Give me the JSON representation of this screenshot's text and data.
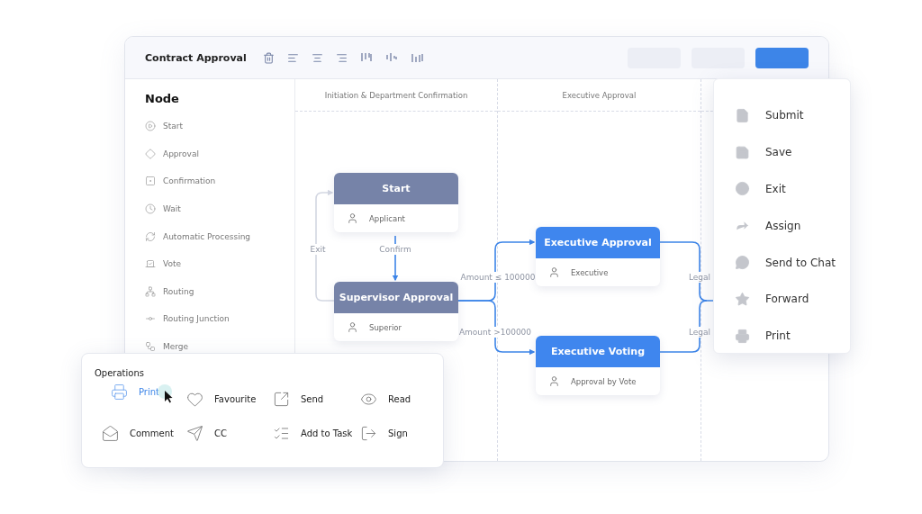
{
  "window": {
    "title": "Contract Approval"
  },
  "header_buttons": [
    {
      "primary": false
    },
    {
      "primary": false
    },
    {
      "primary": true
    }
  ],
  "sidebar": {
    "title": "Node",
    "items": [
      {
        "label": "Start"
      },
      {
        "label": "Approval"
      },
      {
        "label": "Confirmation"
      },
      {
        "label": "Wait"
      },
      {
        "label": "Automatic Processing"
      },
      {
        "label": "Vote"
      },
      {
        "label": "Routing"
      },
      {
        "label": "Routing Junction"
      },
      {
        "label": "Merge"
      }
    ]
  },
  "lanes": [
    {
      "title": "Initiation & Department Confirmation"
    },
    {
      "title": "Executive Approval"
    }
  ],
  "nodes": [
    {
      "title": "Start",
      "assignee": "Applicant",
      "color": "#7683a8"
    },
    {
      "title": "Supervisor Approval",
      "assignee": "Superior",
      "color": "#7683a8"
    },
    {
      "title": "Executive Approval",
      "assignee": "Executive",
      "color": "#3f86ee"
    },
    {
      "title": "Executive Voting",
      "assignee": "Approval by Vote",
      "color": "#3f86ee"
    }
  ],
  "edges": [
    {
      "label": "Confirm",
      "kind": "flow"
    },
    {
      "label": "Exit",
      "kind": "return"
    },
    {
      "label": "Amount ≤ 100000",
      "kind": "flow"
    },
    {
      "label": "Amount >100000",
      "kind": "flow"
    },
    {
      "label": "Legal",
      "kind": "flow"
    },
    {
      "label": "Legal",
      "kind": "flow"
    }
  ],
  "context_menu": {
    "items": [
      {
        "label": "Submit"
      },
      {
        "label": "Save"
      },
      {
        "label": "Exit"
      },
      {
        "label": "Assign"
      },
      {
        "label": "Send to Chat"
      },
      {
        "label": "Forward"
      },
      {
        "label": "Print"
      }
    ]
  },
  "operations": {
    "title": "Operations",
    "items": [
      {
        "label": "Print",
        "selected": true
      },
      {
        "label": "Favourite",
        "selected": false
      },
      {
        "label": "Send",
        "selected": false
      },
      {
        "label": "Read",
        "selected": false
      },
      {
        "label": "Comment",
        "selected": false
      },
      {
        "label": "CC",
        "selected": false
      },
      {
        "label": "Add to Task",
        "selected": false
      },
      {
        "label": "Sign",
        "selected": false
      }
    ]
  }
}
